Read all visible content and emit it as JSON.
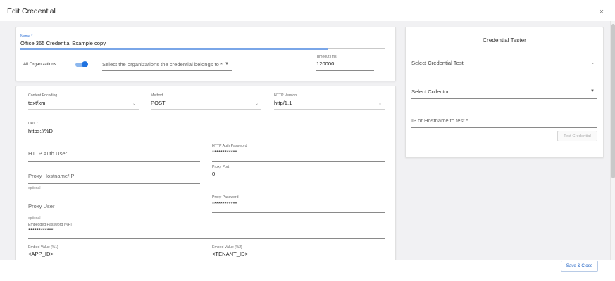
{
  "dialog": {
    "title": "Edit Credential",
    "close_glyph": "×"
  },
  "main_form": {
    "name": {
      "label": "Name *",
      "value": "Office 365 Credential Example copy"
    },
    "all_organizations": {
      "label": "All Organizations",
      "enabled": true
    },
    "organizations": {
      "placeholder": "Select the organizations the credential belongs to *"
    },
    "timeout": {
      "label": "Timeout (ms)",
      "value": "120000"
    }
  },
  "http_form": {
    "content_encoding": {
      "label": "Content Encoding",
      "value": "text/xml"
    },
    "method": {
      "label": "Method",
      "value": "POST"
    },
    "http_version": {
      "label": "HTTP Version",
      "value": "http/1.1"
    },
    "url": {
      "label": "URL *",
      "value": "https://%D"
    },
    "http_auth_user": {
      "placeholder": "HTTP Auth User"
    },
    "http_auth_password": {
      "label": "HTTP Auth Password",
      "value": "************"
    },
    "proxy_hostname": {
      "placeholder": "Proxy Hostname/IP",
      "helper": "optional"
    },
    "proxy_port": {
      "label": "Proxy Port",
      "value": "0"
    },
    "proxy_user": {
      "placeholder": "Proxy User",
      "helper": "optional"
    },
    "proxy_password": {
      "label": "Proxy Password",
      "value": "************"
    },
    "embedded_password": {
      "label": "Embedded Password [%P]",
      "value": "************"
    },
    "embed_value_1": {
      "label": "Embed Value [%1]",
      "value": "<APP_ID>"
    },
    "embed_value_2": {
      "label": "Embed Value [%2]",
      "value": "<TENANT_ID>"
    }
  },
  "credential_tester": {
    "title": "Credential Tester",
    "select_test": {
      "placeholder": "Select Credential Test"
    },
    "select_collector": {
      "placeholder": "Select Collector"
    },
    "ip_hostname": {
      "placeholder": "IP or Hostname to test *"
    },
    "test_button": "Test Credential"
  },
  "footer": {
    "save_close": "Save & Close"
  },
  "colors": {
    "accent": "#1f72e0",
    "background": "#f1f1f3",
    "card": "#ffffff"
  },
  "icons": {
    "dropdown": "caret-down-icon",
    "chevron": "chevron-down-icon",
    "close": "close-icon"
  }
}
